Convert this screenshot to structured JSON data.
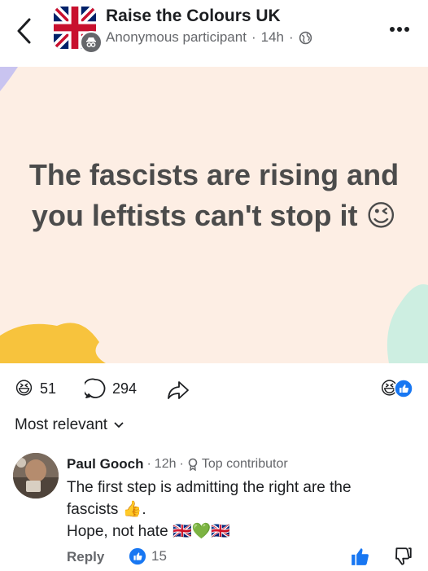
{
  "header": {
    "group_name": "Raise the Colours UK",
    "author": "Anonymous participant",
    "time": "14h",
    "separator": "·",
    "privacy_icon": "globe-icon",
    "more_icon": "more-icon"
  },
  "post": {
    "text": "The fascists are rising and you leftists can't stop it",
    "emoji": "😉",
    "background": "#fdeee4"
  },
  "reactions": {
    "reaction_count": "51",
    "comment_count": "294",
    "reaction_emoji": "😆"
  },
  "sort": {
    "label": "Most relevant"
  },
  "comment": {
    "name": "Paul Gooch",
    "time": "12h",
    "separator": "·",
    "badge": "Top contributor",
    "line1": "The first step is admitting the right are the",
    "line2_text": "fascists",
    "line2_emoji": "👍",
    "line2_end": ".",
    "line3_text": "Hope, not hate",
    "line3_emojis": [
      "🇬🇧",
      "💚",
      "🇬🇧"
    ],
    "reply_label": "Reply",
    "like_count": "15"
  },
  "colors": {
    "accent": "#1877f2",
    "secondary_text": "#65676b",
    "post_text": "#4b4b4b"
  }
}
